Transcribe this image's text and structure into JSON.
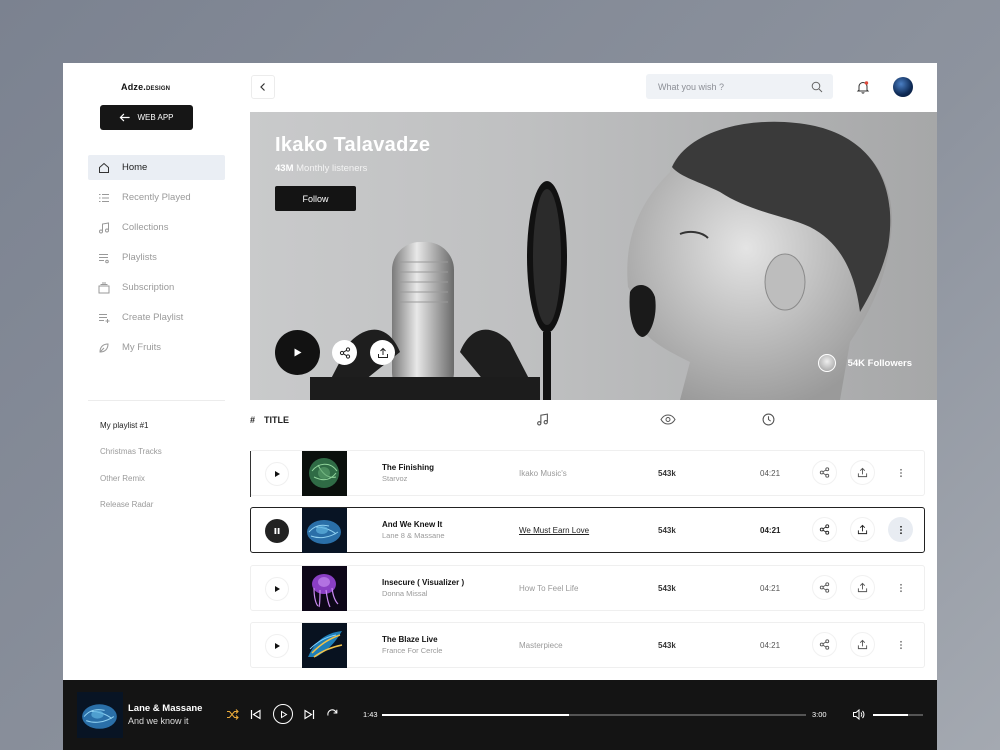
{
  "sidebar": {
    "logo": "Adze.",
    "logo_suffix": "DESIGN",
    "webapp_label": "WEB APP",
    "nav": [
      {
        "label": "Home",
        "icon": "home-icon",
        "active": true
      },
      {
        "label": "Recently Played",
        "icon": "list-icon"
      },
      {
        "label": "Collections",
        "icon": "music-note-icon"
      },
      {
        "label": "Playlists",
        "icon": "playlist-icon"
      },
      {
        "label": "Subscription",
        "icon": "subscription-icon"
      },
      {
        "label": "Create Playlist",
        "icon": "playlist-add-icon"
      },
      {
        "label": "My Fruits",
        "icon": "leaf-icon"
      }
    ],
    "playlists": [
      "My playlist #1",
      "Christmas Tracks",
      "Other Remix",
      "Release Radar"
    ]
  },
  "header": {
    "search_placeholder": "What you wish ?"
  },
  "hero": {
    "artist": "Ikako Talavadze",
    "listeners_count": "43M",
    "listeners_label": "Monthly listeners",
    "follow_label": "Follow",
    "followers": "54K Followers"
  },
  "table": {
    "hash": "#",
    "title_header": "TITLE",
    "rows": [
      {
        "name": "The Finishing",
        "artist": "Starvoz",
        "album": "Ikako Music's",
        "views": "543k",
        "duration": "04:21",
        "playing": false
      },
      {
        "name": "And We Knew It",
        "artist": "Lane 8 & Massane",
        "album": "We Must Earn Love",
        "views": "543k",
        "duration": "04:21",
        "playing": true
      },
      {
        "name": "Insecure ( Visualizer )",
        "artist": "Donna Missal",
        "album": "How To Feel Life",
        "views": "543k",
        "duration": "04:21",
        "playing": false
      },
      {
        "name": "The Blaze Live",
        "artist": "France For Cercle",
        "album": "Masterpiece",
        "views": "543k",
        "duration": "04:21",
        "playing": false
      }
    ]
  },
  "player": {
    "title": "Lane & Massane",
    "subtitle": "And we know it",
    "current_time": "1:43",
    "total_time": "3:00",
    "progress": 0.44,
    "volume": 0.7,
    "shuffle_color": "#e8a93a"
  }
}
